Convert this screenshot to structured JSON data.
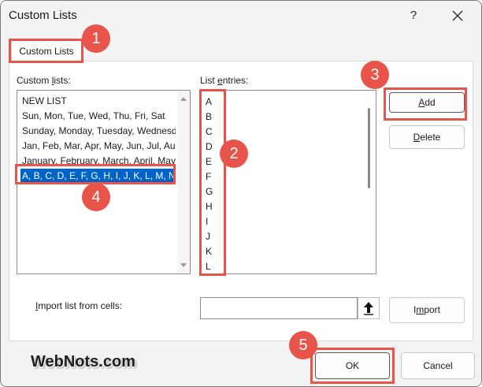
{
  "window": {
    "title": "Custom Lists",
    "help_glyph": "?"
  },
  "tab": {
    "label": "Custom Lists"
  },
  "custom_lists": {
    "label_pre": "Custom ",
    "label_u": "l",
    "label_post": "ists:",
    "items": [
      "NEW LIST",
      "Sun, Mon, Tue, Wed, Thu, Fri, Sat",
      "Sunday, Monday, Tuesday, Wednesday",
      "Jan, Feb, Mar, Apr, May, Jun, Jul, Aug",
      "January, February, March, April, May",
      "A, B, C, D, E, F, G, H, I, J, K, L, M, N"
    ],
    "selected_index": 5
  },
  "list_entries": {
    "label_pre": "List ",
    "label_u": "e",
    "label_post": "ntries:",
    "items": [
      "A",
      "B",
      "C",
      "D",
      "E",
      "F",
      "G",
      "H",
      "I",
      "J",
      "K",
      "L"
    ]
  },
  "buttons": {
    "add": {
      "u": "A",
      "rest": "dd"
    },
    "delete": {
      "u": "D",
      "rest": "elete"
    },
    "import": {
      "pre": "I",
      "u": "m",
      "rest": "port"
    },
    "ok": "OK",
    "cancel": "Cancel"
  },
  "import_row": {
    "label_pre": "",
    "label_u": "I",
    "label_post": "mport list from cells:",
    "value": "",
    "collapse_icon": "arrow-up-icon"
  },
  "annotations": {
    "badges": [
      "1",
      "2",
      "3",
      "4",
      "5"
    ],
    "color": "#e8534a"
  },
  "watermark": "WebNots.com",
  "colors": {
    "selection": "#0063c7",
    "annotation": "#e8534a"
  }
}
